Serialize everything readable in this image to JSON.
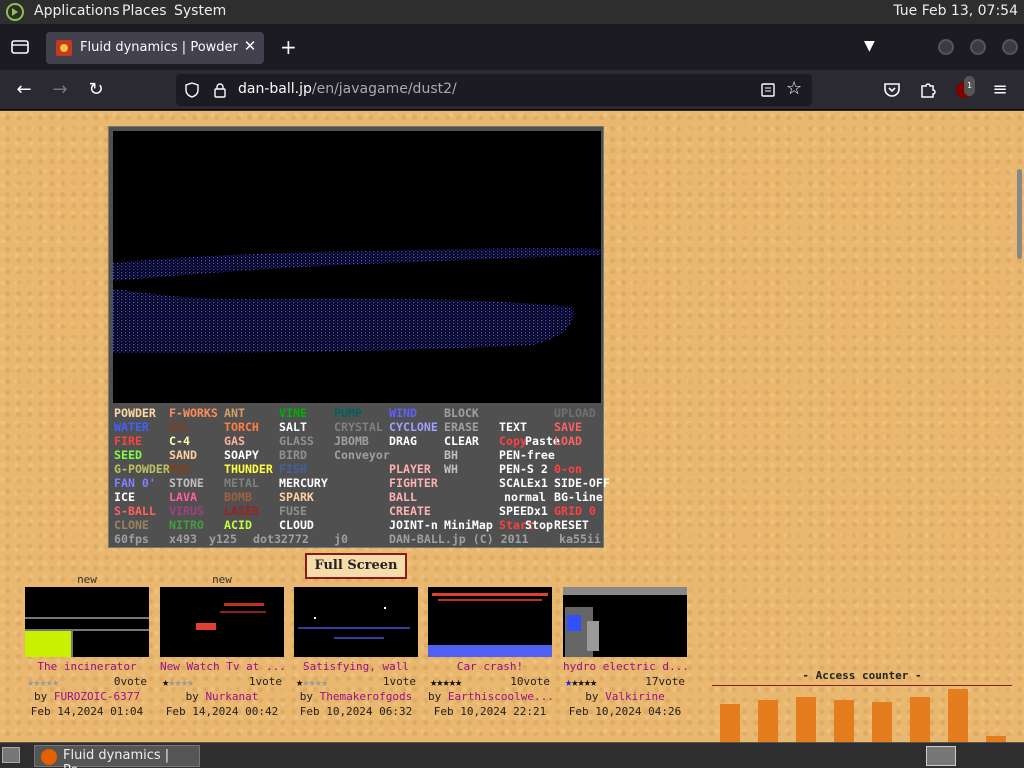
{
  "desktop": {
    "menus": [
      "Applications",
      "Places",
      "System"
    ],
    "clock": "Tue Feb 13, 07:54"
  },
  "browser": {
    "tab_title": "Fluid dynamics | Powder Game",
    "url_host": "dan-ball.jp",
    "url_path": "/en/javagame/dust2/",
    "ublock_badge": "1"
  },
  "game": {
    "menu_items": [
      {
        "label": "POWDER",
        "color": "#ffd9a8"
      },
      {
        "label": "F-WORKS",
        "color": "#ff8c5a"
      },
      {
        "label": "ANT",
        "color": "#d8a060"
      },
      {
        "label": "VINE",
        "color": "#00b000"
      },
      {
        "label": "PUMP",
        "color": "#006060"
      },
      {
        "label": "WIND",
        "color": "#6060ff"
      },
      {
        "label": "BLOCK",
        "color": "#a0a0a0"
      },
      {
        "label": "UPLOAD",
        "color": "#707070"
      },
      {
        "label": "WATER",
        "color": "#4060ff"
      },
      {
        "label": "OIL",
        "color": "#804020"
      },
      {
        "label": "TORCH",
        "color": "#ff8040"
      },
      {
        "label": "SALT",
        "color": "#ffffff"
      },
      {
        "label": "CRYSTAL",
        "color": "#808080"
      },
      {
        "label": "CYCLONE",
        "color": "#a0a0ff"
      },
      {
        "label": "ERASE",
        "color": "#a0a0a0"
      },
      {
        "label": "TEXT",
        "color": "#ffffff"
      },
      {
        "label": "SAVE",
        "color": "#ff6060"
      },
      {
        "label": "FIRE",
        "color": "#ff4040"
      },
      {
        "label": "C-4",
        "color": "#ffffa0"
      },
      {
        "label": "GAS",
        "color": "#ffb0a0"
      },
      {
        "label": "GLASS",
        "color": "#909090"
      },
      {
        "label": "JBOMB",
        "color": "#a0a0a0"
      },
      {
        "label": "DRAG",
        "color": "#ffffff"
      },
      {
        "label": "CLEAR",
        "color": "#ffffff"
      },
      {
        "label": "Copy",
        "color": "#ff4040"
      },
      {
        "label": "Paste",
        "color": "#ffffff"
      },
      {
        "label": "LOAD",
        "color": "#ff6060"
      },
      {
        "label": "SEED",
        "color": "#80ff40"
      },
      {
        "label": "SAND",
        "color": "#ffd0a0"
      },
      {
        "label": "SOAPY",
        "color": "#ffffff"
      },
      {
        "label": "BIRD",
        "color": "#909090"
      },
      {
        "label": "Conveyor",
        "color": "#a0a0a0"
      },
      {
        "label": "BH",
        "color": "#c0c0c0"
      },
      {
        "label": "PEN-free",
        "color": "#ffffff"
      },
      {
        "label": "G-POWDER",
        "color": "#c0c060"
      },
      {
        "label": "MUD",
        "color": "#804020"
      },
      {
        "label": "THUNDER",
        "color": "#ffff40"
      },
      {
        "label": "FISH",
        "color": "#4060a0"
      },
      {
        "label": "PLAYER",
        "color": "#ffb0b0"
      },
      {
        "label": "WH",
        "color": "#c0c0c0"
      },
      {
        "label": "PEN-S 2",
        "color": "#ffffff"
      },
      {
        "label": "0-on",
        "color": "#ff4040"
      },
      {
        "label": "FAN 0'",
        "color": "#8080ff"
      },
      {
        "label": "STONE",
        "color": "#c0c0c0"
      },
      {
        "label": "METAL",
        "color": "#808080"
      },
      {
        "label": "MERCURY",
        "color": "#ffffff"
      },
      {
        "label": "FIGHTER",
        "color": "#ffb0b0"
      },
      {
        "label": "SCALEx1",
        "color": "#ffffff"
      },
      {
        "label": "SIDE-OFF",
        "color": "#ffffff"
      },
      {
        "label": "ICE",
        "color": "#ffffff"
      },
      {
        "label": "LAVA",
        "color": "#ff60a0"
      },
      {
        "label": "BOMB",
        "color": "#a06040"
      },
      {
        "label": "SPARK",
        "color": "#ffd0a0"
      },
      {
        "label": "BALL",
        "color": "#ffb0b0"
      },
      {
        "label": "normal",
        "color": "#ffffff"
      },
      {
        "label": "BG-line",
        "color": "#ffffff"
      },
      {
        "label": "S-BALL",
        "color": "#ff6060"
      },
      {
        "label": "VIRUS",
        "color": "#a04080"
      },
      {
        "label": "LASER",
        "color": "#a02020"
      },
      {
        "label": "FUSE",
        "color": "#909090"
      },
      {
        "label": "CREATE",
        "color": "#ffb0b0"
      },
      {
        "label": "SPEEDx1",
        "color": "#ffffff"
      },
      {
        "label": "GRID 0",
        "color": "#ff4040"
      },
      {
        "label": "CLONE",
        "color": "#a08060"
      },
      {
        "label": "NITRO",
        "color": "#40a040"
      },
      {
        "label": "ACID",
        "color": "#c0ff40"
      },
      {
        "label": "CLOUD",
        "color": "#ffffff"
      },
      {
        "label": "JOINT-n",
        "color": "#ffffff"
      },
      {
        "label": "MiniMap",
        "color": "#ffffff"
      },
      {
        "label": "Start",
        "color": "#ff4040"
      },
      {
        "label": "Stop",
        "color": "#ffffff"
      },
      {
        "label": "RESET",
        "color": "#ffffff"
      }
    ],
    "status": {
      "fps": "60fps",
      "x": "x493",
      "y": "y125",
      "dot": "dot32772",
      "j": "j0",
      "credit": "DAN-BALL.jp (C) 2011",
      "ver": "ka55ii"
    }
  },
  "fullscreen_label": "Full Screen",
  "uploads": [
    {
      "new": "new",
      "title": "The incinerator",
      "filled_stars": 0,
      "votes": "0vote",
      "by": "by",
      "author": "FUROZOIC-6377",
      "date": "Feb 14,2024 01:04"
    },
    {
      "new": "new",
      "title": "New Watch Tv at ...",
      "filled_stars": 1,
      "votes": "1vote",
      "by": "by",
      "author": "Nurkanat",
      "date": "Feb 14,2024 00:42"
    },
    {
      "new": "",
      "title": "Satisfying, wall",
      "filled_stars": 1,
      "votes": "1vote",
      "by": "by",
      "author": "Themakerofgods",
      "date": "Feb 10,2024 06:32"
    },
    {
      "new": "",
      "title": "Car crash!",
      "filled_stars": 5,
      "votes": "10vote",
      "by": "by",
      "author": "Earthiscoolwe...",
      "date": "Feb 10,2024 22:21"
    },
    {
      "new": "",
      "title": "hydro electric d...",
      "filled_stars": 5,
      "votes": "17vote",
      "by": "by",
      "author": "Valkirine",
      "date": "Feb 10,2024 04:26"
    }
  ],
  "counter": {
    "title": "- Access counter -",
    "bars": [
      0.62,
      0.68,
      0.72,
      0.68,
      0.65,
      0.72,
      0.85,
      0.1
    ]
  },
  "taskbar": {
    "item": "Fluid dynamics | Po..."
  },
  "colors": {
    "accent": "#8b1a1a",
    "page_bg": "#e9b86e",
    "link": "#9a0f8a",
    "bar": "#e37d1e"
  }
}
